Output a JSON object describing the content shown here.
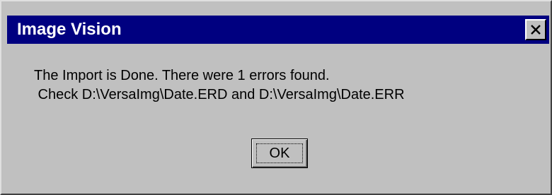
{
  "dialog": {
    "title": "Image Vision",
    "close_icon": "close-icon",
    "message_lines": [
      "The Import is Done. There were 1 errors found.",
      " Check D:\\VersaImg\\Date.ERD and D:\\VersaImg\\Date.ERR"
    ],
    "ok_label": "OK"
  },
  "colors": {
    "titlebar": "#000080",
    "face": "#c0c0c0",
    "title_text": "#ffffff"
  }
}
